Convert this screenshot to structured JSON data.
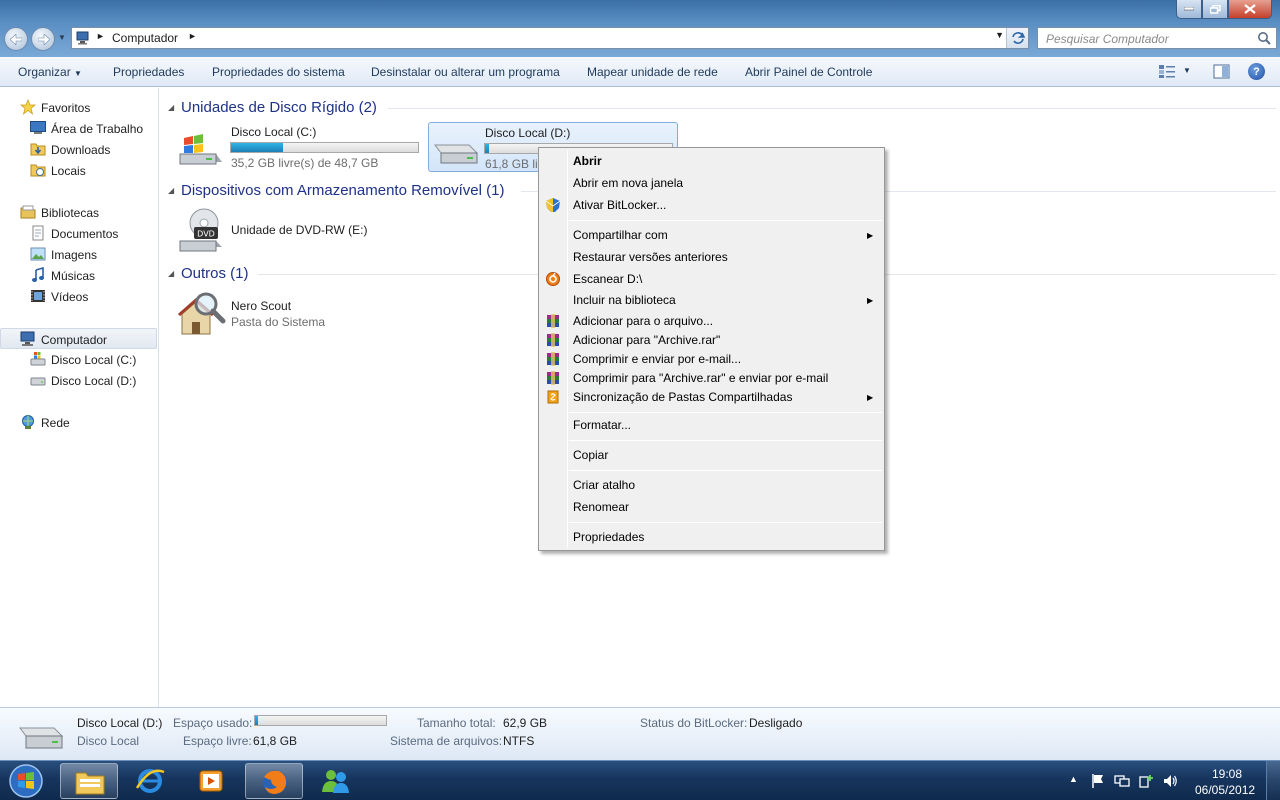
{
  "address": {
    "path": "Computador"
  },
  "search": {
    "placeholder": "Pesquisar Computador"
  },
  "toolbar": {
    "organize": "Organizar",
    "properties": "Propriedades",
    "system_properties": "Propriedades do sistema",
    "uninstall": "Desinstalar ou alterar um programa",
    "map_drive": "Mapear unidade de rede",
    "control_panel": "Abrir Painel de Controle"
  },
  "nav": {
    "favorites": "Favoritos",
    "desktop": "Área de Trabalho",
    "downloads": "Downloads",
    "places": "Locais",
    "libraries": "Bibliotecas",
    "documents": "Documentos",
    "images": "Imagens",
    "music": "Músicas",
    "videos": "Vídeos",
    "computer": "Computador",
    "disk_c": "Disco Local (C:)",
    "disk_d": "Disco Local (D:)",
    "network": "Rede"
  },
  "groups": {
    "hdd": "Unidades de Disco Rígido (2)",
    "removable": "Dispositivos com Armazenamento Removível (1)",
    "others": "Outros (1)"
  },
  "drives": {
    "c": {
      "name": "Disco Local (C:)",
      "free": "35,2 GB livre(s) de 48,7 GB",
      "used_fraction": 0.28
    },
    "d": {
      "name": "Disco Local (D:)",
      "free": "61,8 GB livre",
      "used_fraction": 0.02
    },
    "dvd": {
      "name": "Unidade de DVD-RW (E:)",
      "label": "DVD"
    },
    "nero": {
      "name": "Nero Scout",
      "sub": "Pasta do Sistema"
    }
  },
  "menu": {
    "open": "Abrir",
    "open_new": "Abrir em nova janela",
    "bitlocker": "Ativar BitLocker...",
    "share": "Compartilhar com",
    "restore": "Restaurar versões anteriores",
    "scan": "Escanear D:\\",
    "include": "Incluir na biblioteca",
    "add_archive": "Adicionar para o arquivo...",
    "add_rar": "Adicionar para \"Archive.rar\"",
    "compress_email": "Comprimir e enviar por e-mail...",
    "compress_rar_email": "Comprimir para \"Archive.rar\" e enviar por e-mail",
    "sync": "Sincronização de Pastas Compartilhadas",
    "format": "Formatar...",
    "copy": "Copiar",
    "shortcut": "Criar atalho",
    "rename": "Renomear",
    "properties": "Propriedades"
  },
  "details": {
    "name": "Disco Local (D:)",
    "type": "Disco Local",
    "used_label": "Espaço usado:",
    "used_fraction": 0.02,
    "free_label": "Espaço livre:",
    "free_value": "61,8 GB",
    "total_label": "Tamanho total:",
    "total_value": "62,9 GB",
    "fs_label": "Sistema de arquivos:",
    "fs_value": "NTFS",
    "bitlocker_label": "Status do BitLocker:",
    "bitlocker_value": "Desligado"
  },
  "taskbar": {
    "time": "19:08",
    "date": "06/05/2012"
  },
  "colors": {
    "accent": "#1e3287",
    "progress": "#1d7fb6",
    "taskbar": "#16355e"
  }
}
